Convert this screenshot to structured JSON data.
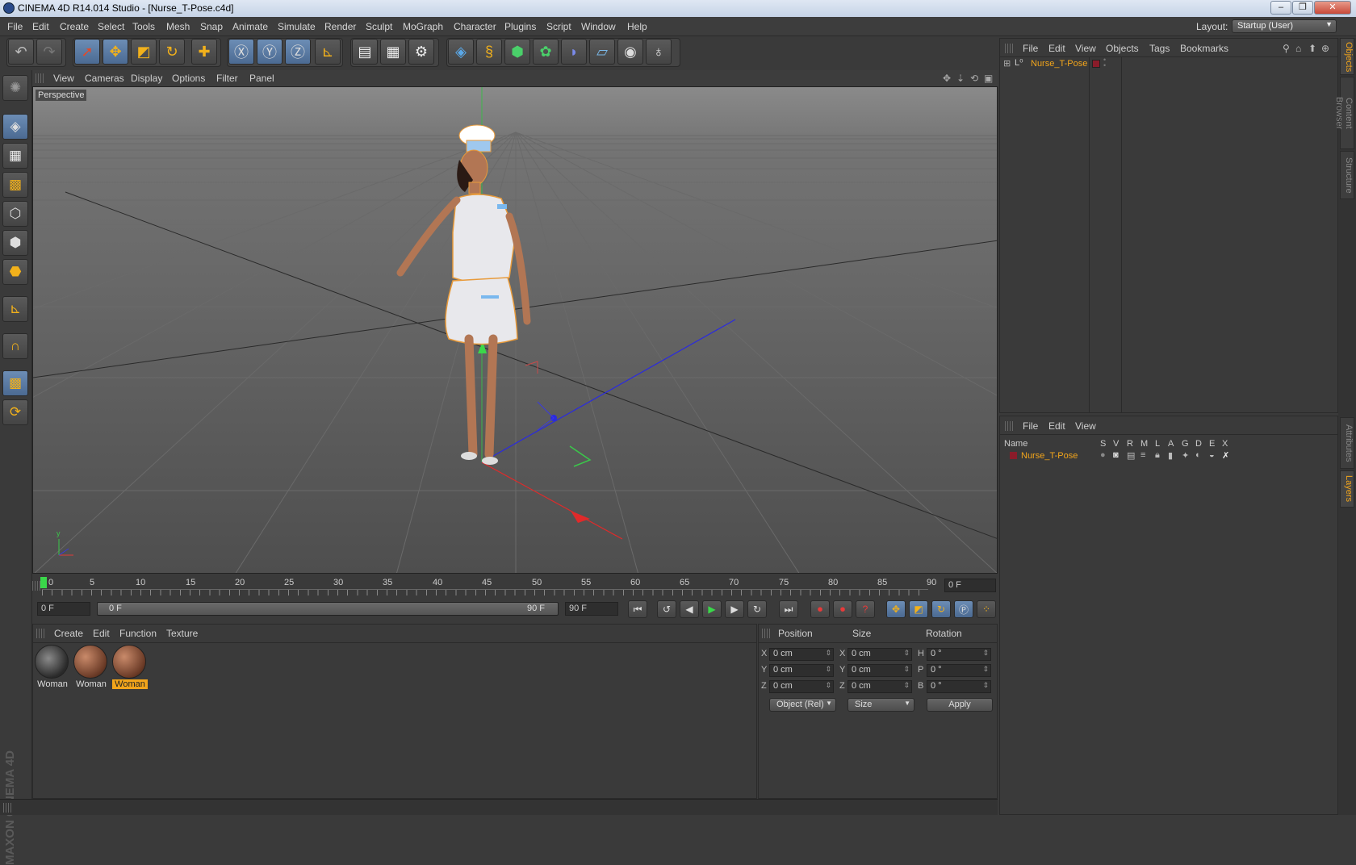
{
  "window": {
    "title": "CINEMA 4D R14.014 Studio - [Nurse_T-Pose.c4d]",
    "min": "‒",
    "max": "❐",
    "close": "✕"
  },
  "menu": [
    "File",
    "Edit",
    "Create",
    "Select",
    "Tools",
    "Mesh",
    "Snap",
    "Animate",
    "Simulate",
    "Render",
    "Sculpt",
    "MoGraph",
    "Character",
    "Plugins",
    "Script",
    "Window",
    "Help"
  ],
  "layout": {
    "label": "Layout:",
    "value": "Startup (User)"
  },
  "viewport": {
    "menu": [
      "View",
      "Cameras",
      "Display",
      "Options",
      "Filter",
      "Panel"
    ],
    "label": "Perspective"
  },
  "timeline": {
    "ticks": [
      "0",
      "5",
      "10",
      "15",
      "20",
      "25",
      "30",
      "35",
      "40",
      "45",
      "50",
      "55",
      "60",
      "65",
      "70",
      "75",
      "80",
      "85",
      "90"
    ],
    "current": "0 F"
  },
  "transport": {
    "start": "0 F",
    "range_start": "0 F",
    "range_end": "90 F",
    "end": "90 F"
  },
  "materials": {
    "menu": [
      "Create",
      "Edit",
      "Function",
      "Texture"
    ],
    "items": [
      {
        "name": "Woman"
      },
      {
        "name": "Woman"
      },
      {
        "name": "Woman"
      }
    ]
  },
  "attributes": {
    "headers": {
      "position": "Position",
      "size": "Size",
      "rotation": "Rotation"
    },
    "rows": [
      {
        "axis": "X",
        "pos": "0 cm",
        "saxis": "X",
        "size": "0 cm",
        "raxis": "H",
        "rot": "0 °"
      },
      {
        "axis": "Y",
        "pos": "0 cm",
        "saxis": "Y",
        "size": "0 cm",
        "raxis": "P",
        "rot": "0 °"
      },
      {
        "axis": "Z",
        "pos": "0 cm",
        "saxis": "Z",
        "size": "0 cm",
        "raxis": "B",
        "rot": "0 °"
      }
    ],
    "coord_mode": "Object (Rel)",
    "size_mode": "Size",
    "apply": "Apply"
  },
  "object_manager": {
    "menu": [
      "File",
      "Edit",
      "View",
      "Objects",
      "Tags",
      "Bookmarks"
    ],
    "objects": [
      {
        "name": "Nurse_T-Pose"
      }
    ]
  },
  "layer_manager": {
    "menu": [
      "File",
      "Edit",
      "View"
    ],
    "columns": [
      "Name",
      "S",
      "V",
      "R",
      "M",
      "L",
      "A",
      "G",
      "D",
      "E",
      "X"
    ],
    "layers": [
      {
        "name": "Nurse_T-Pose"
      }
    ]
  },
  "right_tabs": [
    "Objects",
    "Content Browser",
    "Structure",
    "Attributes",
    "Layers"
  ],
  "brand": "MAXON CINEMA 4D",
  "colors": {
    "accent": "#f2a51b",
    "selected_blue": "#6c8db5",
    "layer_color": "#8a1c2a"
  },
  "icons": {
    "toolbar": [
      "undo-icon",
      "redo-icon",
      "live-select-icon",
      "move-icon",
      "scale-icon",
      "rotate-icon",
      "recent-tool-icon",
      "x-axis-lock-icon",
      "y-axis-lock-icon",
      "z-axis-lock-icon",
      "coordinate-system-icon",
      "render-view-icon",
      "render-picture-viewer-icon",
      "render-settings-icon",
      "cube-primitive-icon",
      "spline-icon",
      "nurbs-icon",
      "array-icon",
      "deformer-icon",
      "floor-icon",
      "camera-icon",
      "light-icon"
    ],
    "left": [
      "make-editable-icon",
      "model-mode-icon",
      "texture-mode-icon",
      "workplane-icon",
      "points-mode-icon",
      "edges-mode-icon",
      "polygons-mode-icon",
      "axis-mode-icon",
      "snap-magnet-icon",
      "workplane-lock-icon",
      "soft-selection-icon"
    ]
  }
}
